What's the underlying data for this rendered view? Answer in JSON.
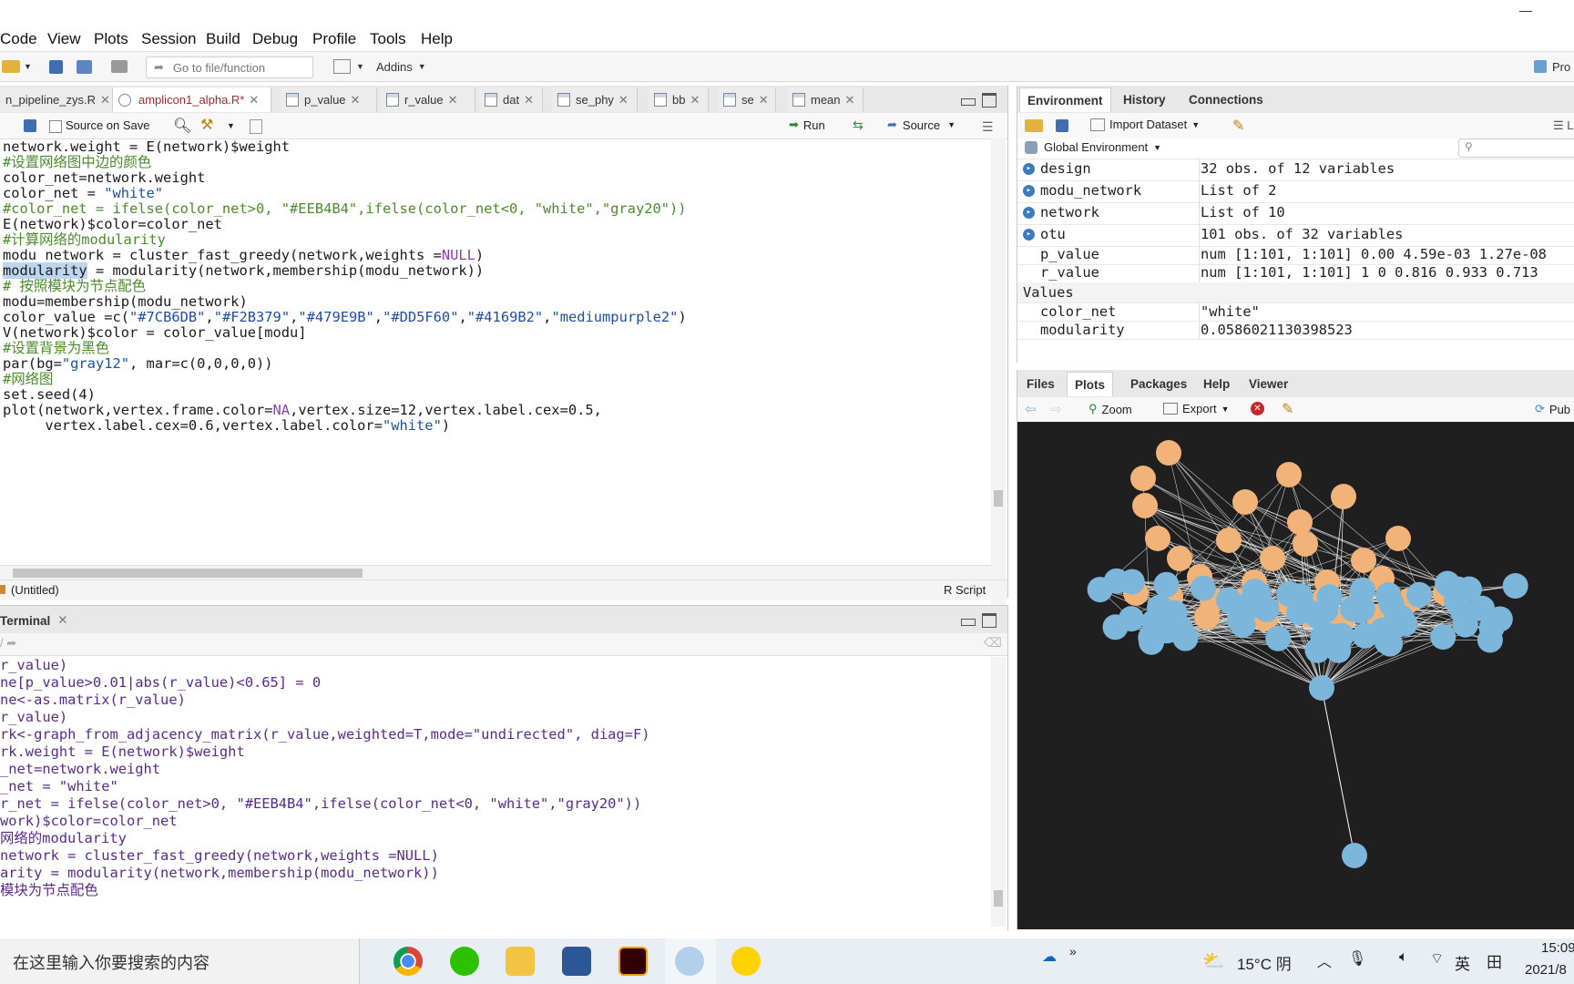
{
  "menu": [
    "Code",
    "View",
    "Plots",
    "Session",
    "Build",
    "Debug",
    "Profile",
    "Tools",
    "Help"
  ],
  "toolbar": {
    "goto_placeholder": "Go to file/function",
    "addins": "Addins",
    "project": "Pro"
  },
  "source_tabs": [
    {
      "label": "n_pipeline_zys.R",
      "active": false
    },
    {
      "label": "amplicon1_alpha.R*",
      "active": true
    },
    {
      "label": "p_value",
      "active": false
    },
    {
      "label": "r_value",
      "active": false
    },
    {
      "label": "dat",
      "active": false
    },
    {
      "label": "se_phy",
      "active": false
    },
    {
      "label": "bb",
      "active": false
    },
    {
      "label": "se",
      "active": false
    },
    {
      "label": "mean",
      "active": false
    }
  ],
  "source_toolbar": {
    "source_on_save": "Source on Save",
    "run": "Run",
    "source": "Source"
  },
  "code_lines": [
    "network.weight = E(network)$weight",
    "#设置网络图中边的颜色",
    "color_net=network.weight",
    "color_net = \"white\"",
    "#color_net = ifelse(color_net>0, \"#EEB4B4\",ifelse(color_net<0, \"white\",\"gray20\"))",
    "E(network)$color=color_net",
    "#计算网络的modularity",
    "modu_network = cluster_fast_greedy(network,weights =NULL)",
    "modularity = modularity(network,membership(modu_network))",
    "# 按照模块为节点配色",
    "modu=membership(modu_network)",
    "color_value =c(\"#7CB6DB\",\"#F2B379\",\"#479E9B\",\"#DD5F60\",\"#4169B2\",\"mediumpurple2\")",
    "V(network)$color = color_value[modu]",
    "#设置背景为黑色",
    "par(bg=\"gray12\", mar=c(0,0,0,0))",
    "#网络图",
    "set.seed(4)",
    "plot(network,vertex.frame.color=NA,vertex.size=12,vertex.label.cex=0.5,",
    "     vertex.label.cex=0.6,vertex.label.color=\"white\")"
  ],
  "source_status": {
    "scope": "(Untitled)",
    "filetype": "R Script"
  },
  "console_tab": "Terminal",
  "console_lines": [
    "r_value)",
    "ne[p_value>0.01|abs(r_value)<0.65] = 0",
    "ne<-as.matrix(r_value)",
    "r_value)",
    "rk<-graph_from_adjacency_matrix(r_value,weighted=T,mode=\"undirected\", diag=F)",
    "rk.weight = E(network)$weight",
    "_net=network.weight",
    "_net = \"white\"",
    "r_net = ifelse(color_net>0, \"#EEB4B4\",ifelse(color_net<0, \"white\",\"gray20\"))",
    "work)$color=color_net",
    "网络的modularity",
    "network = cluster_fast_greedy(network,weights =NULL)",
    "arity = modularity(network,membership(modu_network))",
    "模块为节点配色"
  ],
  "env_tabs": [
    "Environment",
    "History",
    "Connections"
  ],
  "env_toolbar": {
    "import": "Import Dataset",
    "scope": "Global Environment",
    "right_cut": "L"
  },
  "env_data": [
    {
      "name": "design",
      "value": "32 obs. of 12 variables"
    },
    {
      "name": "modu_network",
      "value": "List of 2"
    },
    {
      "name": "network",
      "value": "List of 10"
    },
    {
      "name": "otu",
      "value": "101 obs. of 32 variables"
    },
    {
      "name": "p_value",
      "value": "num [1:101, 1:101] 0.00 4.59e-03 1.27e-08"
    },
    {
      "name": "r_value",
      "value": "num [1:101, 1:101] 1 0 0.816 0.933 0.713"
    }
  ],
  "env_values_header": "Values",
  "env_values": [
    {
      "name": "color_net",
      "value": "\"white\""
    },
    {
      "name": "modularity",
      "value": "0.0586021130398523"
    }
  ],
  "plot_tabs": [
    "Files",
    "Plots",
    "Packages",
    "Help",
    "Viewer"
  ],
  "plot_toolbar": {
    "zoom": "Zoom",
    "export": "Export",
    "publish": "Pub"
  },
  "colors": {
    "node_blue": "#7CB6DB",
    "node_orange": "#F2B379",
    "plot_bg": "#1f1f1f"
  },
  "taskbar": {
    "search": "在这里输入你要搜索的内容",
    "weather": "15°C 阴",
    "ime": "英",
    "time": "15:09",
    "date": "2021/8"
  }
}
